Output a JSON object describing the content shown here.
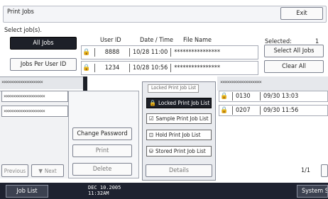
{
  "title": "Print Jobs",
  "exit_label": "Exit",
  "select_prompt": "Select job(s).",
  "left_buttons": {
    "all_jobs": "All Jobs",
    "per_user": "Jobs Per User ID"
  },
  "columns": {
    "user_id": "User ID",
    "datetime": "Date / Time",
    "file_name": "File Name"
  },
  "rows": [
    {
      "user": "8888",
      "time": "10/28 11:00",
      "file": "****************"
    },
    {
      "user": "1234",
      "time": "10/28 10:56",
      "file": "****************"
    }
  ],
  "selected_label": "Selected:",
  "selected_count": "1",
  "select_all_label": "Select All Jobs",
  "clear_all_label": "Clear All",
  "popup_header": "Locked Print Job List",
  "popup_items": [
    "Locked Print Job List",
    "Sample Print Job List",
    "Hold Print Job List",
    "Stored Print Job List"
  ],
  "right_rows": [
    {
      "user": "0130",
      "time": "09/30 13:03"
    },
    {
      "user": "0207",
      "time": "09/30 11:56"
    }
  ],
  "mid_buttons": {
    "change_password": "Change Password",
    "print": "Print",
    "delete": "Delete"
  },
  "details_label": "Details",
  "page_indicator": "1/1",
  "prev_label": "Previous",
  "next_label": "Next",
  "footer": {
    "job_list": "Job List",
    "date": "DEC  10.2005",
    "time": "11:32AM",
    "system": "System Stat"
  },
  "masked_short": "****************",
  "hatch_text": "××××××××××××××××××"
}
